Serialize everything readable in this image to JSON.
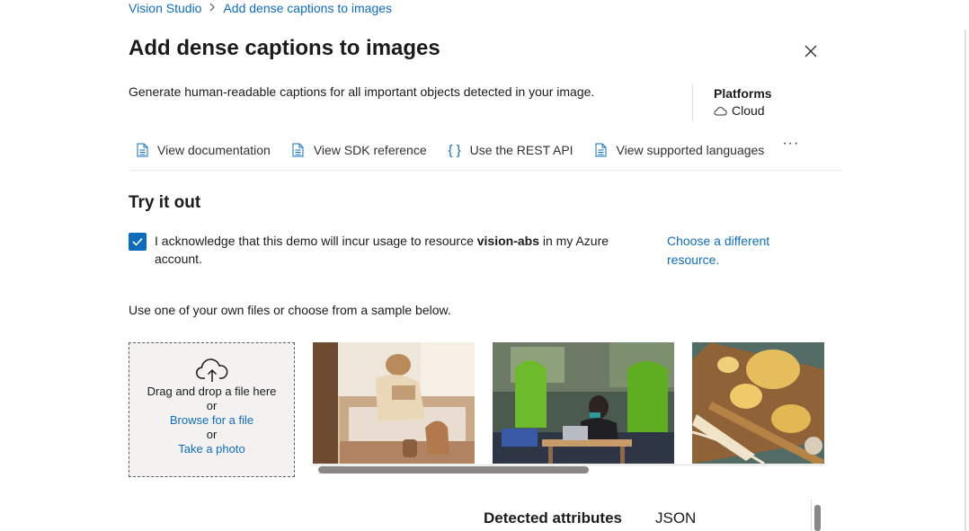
{
  "breadcrumb": {
    "root": "Vision Studio",
    "separator": ">",
    "current": "Add dense captions to images"
  },
  "page": {
    "title": "Add dense captions to images",
    "description": "Generate human-readable captions for all important objects detected in your image."
  },
  "platforms": {
    "title": "Platforms",
    "value": "Cloud"
  },
  "links": [
    {
      "label": "View documentation",
      "icon": "document-icon"
    },
    {
      "label": "View SDK reference",
      "icon": "document-icon"
    },
    {
      "label": "Use the REST API",
      "icon": "braces-icon"
    },
    {
      "label": "View supported languages",
      "icon": "document-icon"
    }
  ],
  "more_label": "···",
  "try_it": {
    "title": "Try it out",
    "ack_prefix": "I acknowledge that this demo will incur usage to resource",
    "resource_name": "vision-abs",
    "ack_suffix": "in my Azure account.",
    "acknowledged": true,
    "choose_link": "Choose a different resource."
  },
  "upload": {
    "instructions": "Use one of your own files or choose from a sample below.",
    "drag_text": "Drag and drop a file here",
    "or1": "or",
    "browse": "Browse for a file",
    "or2": "or",
    "photo": "Take a photo"
  },
  "results": {
    "tab_attributes": "Detected attributes",
    "tab_json": "JSON"
  },
  "colors": {
    "accent": "#0f6cbd",
    "text": "#1b1b1b"
  }
}
